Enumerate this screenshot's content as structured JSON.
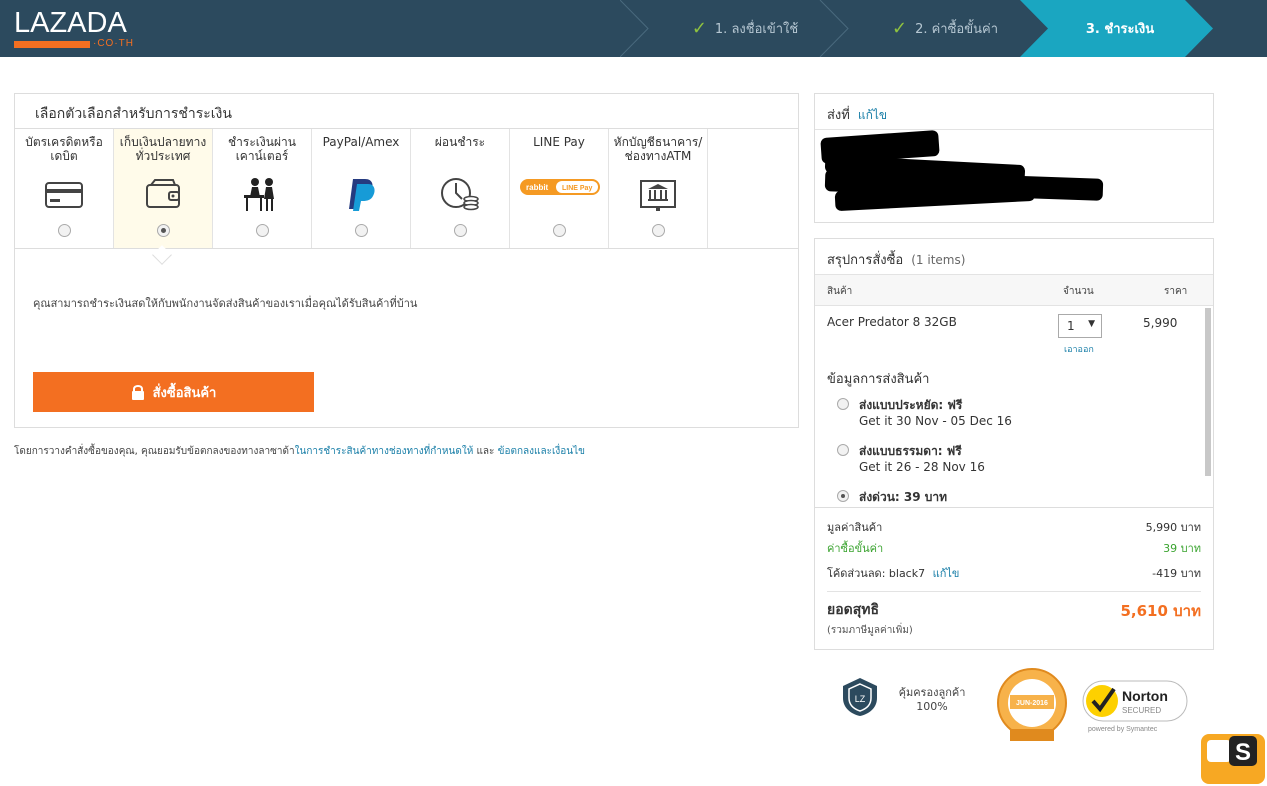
{
  "header": {
    "logo_text": "LAZADA",
    "logo_sub": "·CO·TH",
    "steps": [
      {
        "label": "1. ลงชื่อเข้าใช้",
        "done": true
      },
      {
        "label": "2. ค่าซื้อขั้นค่า",
        "done": true
      },
      {
        "label": "3. ชำระเงิน",
        "active": true
      }
    ]
  },
  "payment": {
    "title": "เลือกตัวเลือกสำหรับการชำระเงิน",
    "methods": [
      {
        "label": "บัตรเครดิตหรือ เดบิต",
        "icon": "credit-card-icon",
        "selected": false
      },
      {
        "label": "เก็บเงินปลายทาง ทั่วประเทศ",
        "icon": "wallet-icon",
        "selected": true
      },
      {
        "label": "ชำระเงินผ่าน เคาน์เตอร์",
        "icon": "counter-icon",
        "selected": false
      },
      {
        "label": "PayPal/Amex",
        "icon": "paypal-icon",
        "selected": false
      },
      {
        "label": "ผ่อนชำระ",
        "icon": "installment-icon",
        "selected": false
      },
      {
        "label": "LINE Pay",
        "icon": "line-pay-icon",
        "selected": false
      },
      {
        "label": "หักบัญชีธนาคาร/ ช่องทางATM",
        "icon": "bank-icon",
        "selected": false
      }
    ],
    "description": "คุณสามารถชำระเงินสดให้กับพนักงานจัดส่งสินค้าของเราเมื่อคุณได้รับสินค้าที่บ้าน",
    "order_button": "สั่งซื้อสินค้า",
    "terms_prefix": "โดยการวางคำสั่งซื้อของคุณ, คุณยอมรับข้อตกลงของทางลาซาด้า",
    "terms_link1": "ในการชำระสินค้าทางช่องทางที่กำหนดให้",
    "terms_and": " และ ",
    "terms_link2": "ข้อตกลงและเงื่อนไข"
  },
  "shipping": {
    "title": "ส่งที่",
    "edit": "แก้ไข"
  },
  "summary": {
    "title": "สรุปการสั่งซื้อ",
    "count": "(1 items)",
    "col_product": "สินค้า",
    "col_qty": "จำนวน",
    "col_price": "ราคา",
    "item_name": "Acer Predator 8 32GB",
    "item_qty": "1",
    "item_remove": "เอาออก",
    "item_price": "5,990",
    "ship_info_title": "ข้อมูลการส่งสินค้า",
    "ship_options": [
      {
        "title": "ส่งแบบประหยัด: ฟรี",
        "sub": "Get it 30 Nov - 05 Dec 16",
        "selected": false
      },
      {
        "title": "ส่งแบบธรรมดา: ฟรี",
        "sub": "Get it 26 - 28 Nov 16",
        "selected": false
      },
      {
        "title": "ส่งด่วน: 39 บาท",
        "sub": "",
        "selected": true
      }
    ],
    "subtotal_label": "มูลค่าสินค้า",
    "subtotal_value": "5,990 บาท",
    "shipping_label": "ค่าซื้อขั้นค่า",
    "shipping_value": "39 บาท",
    "discount_label": "โค้ดส่วนลด: black7",
    "discount_edit": "แก้ไข",
    "discount_value": "-419 บาท",
    "total_label": "ยอดสุทธิ",
    "total_sub": "(รวมภาษีมูลค่าเพิ่ม)",
    "total_value": "5,610 บาท"
  },
  "badges": {
    "guarantee_line1": "คุ้มครองลูกค้า",
    "guarantee_line2": "100%",
    "norton": "Norton",
    "norton_secured": "SECURED",
    "norton_powered": "powered by Symantec",
    "pci_date": "JUN-2016"
  }
}
